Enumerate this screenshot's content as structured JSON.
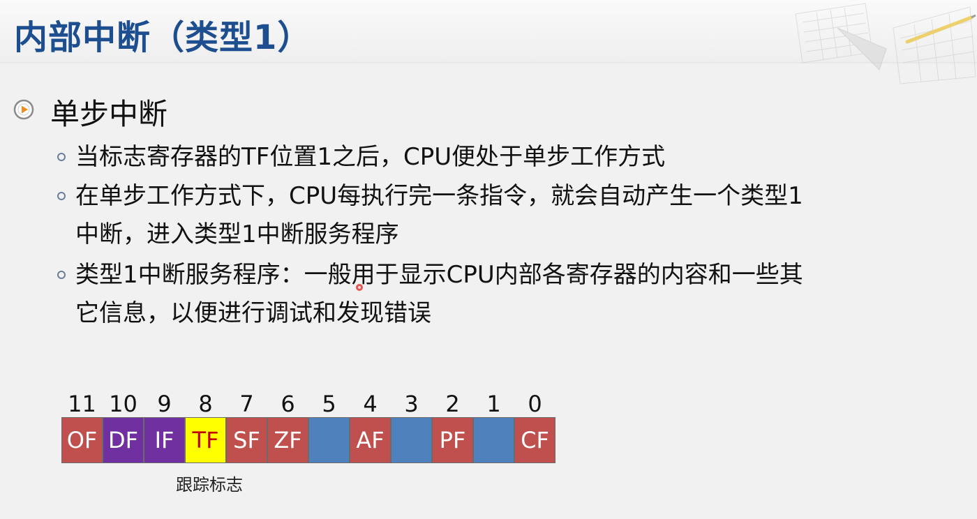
{
  "slide": {
    "title": "内部中断（类型1）"
  },
  "section": {
    "heading": "单步中断",
    "icon": "play-circle-icon",
    "items": [
      {
        "lines": [
          "当标志寄存器的TF位置1之后，CPU便处于单步工作方式"
        ]
      },
      {
        "lines": [
          "在单步工作方式下，CPU每执行完一条指令，就会自动产生一个类型1",
          "中断，进入类型1中断服务程序"
        ]
      },
      {
        "lines": [
          "类型1中断服务程序：一般用于显示CPU内部各寄存器的内容和一些其",
          "它信息，以便进行调试和发现错误"
        ]
      }
    ]
  },
  "flags_register": {
    "bit_numbers": [
      "11",
      "10",
      "9",
      "8",
      "7",
      "6",
      "5",
      "4",
      "3",
      "2",
      "1",
      "0"
    ],
    "flags": [
      {
        "label": "OF",
        "color": "#c0504d"
      },
      {
        "label": "DF",
        "color": "#7030a0"
      },
      {
        "label": "IF",
        "color": "#7030a0"
      },
      {
        "label": "TF",
        "color": "#ffff00",
        "text_color": "#c00000"
      },
      {
        "label": "SF",
        "color": "#c0504d"
      },
      {
        "label": "ZF",
        "color": "#c0504d"
      },
      {
        "label": "",
        "color": "#4f81bd"
      },
      {
        "label": "AF",
        "color": "#c0504d"
      },
      {
        "label": "",
        "color": "#4f81bd"
      },
      {
        "label": "PF",
        "color": "#c0504d"
      },
      {
        "label": "",
        "color": "#4f81bd"
      },
      {
        "label": "CF",
        "color": "#c0504d"
      }
    ],
    "caption": "跟踪标志"
  },
  "colors": {
    "title": "#1d4e8f",
    "bullet_orange": "#f28c1e"
  }
}
